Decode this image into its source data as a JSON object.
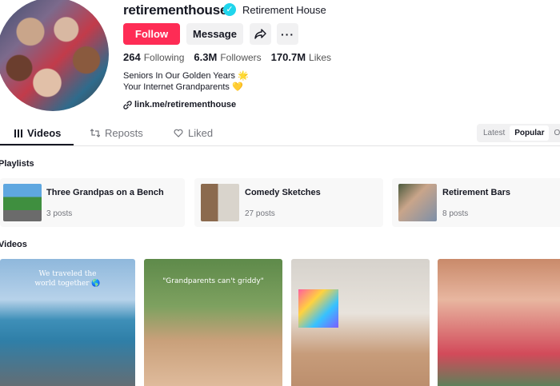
{
  "profile": {
    "username": "retirementhouse",
    "nickname": "Retirement House",
    "bio_line1": "Seniors In Our Golden Years 🌟",
    "bio_line2": "Your Internet Grandparents 💛",
    "link": "link.me/retirementhouse"
  },
  "buttons": {
    "follow": "Follow",
    "message": "Message",
    "more": "···"
  },
  "stats": {
    "following_count": "264",
    "following_label": "Following",
    "followers_count": "6.3M",
    "followers_label": "Followers",
    "likes_count": "170.7M",
    "likes_label": "Likes"
  },
  "tabs": {
    "videos": "Videos",
    "reposts": "Reposts",
    "liked": "Liked"
  },
  "sort": {
    "latest": "Latest",
    "popular": "Popular",
    "oldest": "Old"
  },
  "sections": {
    "playlists": "Playlists",
    "videos": "Videos"
  },
  "playlists": [
    {
      "title": "Three Grandpas on a Bench",
      "count": "3 posts"
    },
    {
      "title": "Comedy Sketches",
      "count": "27 posts"
    },
    {
      "title": "Retirement Bars",
      "count": "8 posts"
    }
  ],
  "videos": [
    {
      "caption": "We traveled the world together 🌎"
    },
    {
      "caption": "\"Grandparents can't griddy\""
    },
    {
      "caption": ""
    },
    {
      "caption": ""
    }
  ],
  "icons": [
    "verified-icon",
    "share-icon",
    "link-icon",
    "grid-icon",
    "repost-icon",
    "heart-icon"
  ],
  "colors": {
    "accent": "#fe2c55",
    "verified": "#20d5ec"
  }
}
